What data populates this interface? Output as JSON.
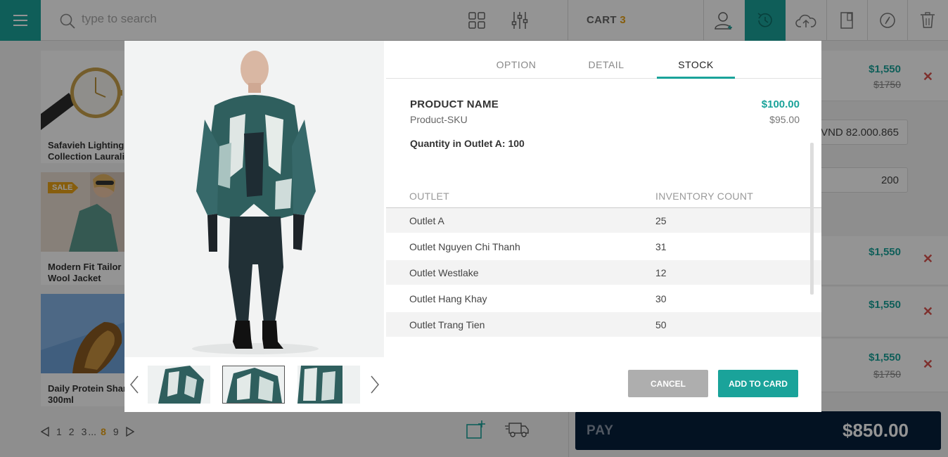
{
  "search": {
    "placeholder": "type to search"
  },
  "cart": {
    "label": "CART",
    "count": "3"
  },
  "products": [
    {
      "name_line1": "Safavieh Lighting",
      "name_line2": "Collection Laurali"
    },
    {
      "name_line1": "Modern Fit Tailor",
      "name_line2": "Wool Jacket",
      "badge": "SALE"
    },
    {
      "name_line1": "Daily Protein Shar",
      "name_line2": "300ml"
    }
  ],
  "pagination": {
    "pages": [
      "1",
      "2",
      "3",
      "...",
      "8",
      "9"
    ],
    "current": "8"
  },
  "cart_panel": {
    "items": [
      {
        "price": "$1,550",
        "old_price": "$1750"
      },
      {
        "price": "$1,550"
      },
      {
        "price": "$1,550"
      },
      {
        "price": "$1,550",
        "old_price": "$1750"
      }
    ],
    "currency_value": "VND 82.000.865",
    "quantity_value": "200",
    "pay_label": "PAY",
    "pay_amount": "$850.00"
  },
  "modal": {
    "tabs": [
      {
        "label": "OPTION"
      },
      {
        "label": "DETAIL"
      },
      {
        "label": "STOCK"
      }
    ],
    "active_tab": "STOCK",
    "product_name": "PRODUCT NAME",
    "sku": "Product-SKU",
    "price": "$100.00",
    "secondary_price": "$95.00",
    "quantity_note": "Quantity in Outlet A: 100",
    "table": {
      "headers": [
        "OUTLET",
        "INVENTORY COUNT"
      ],
      "rows": [
        [
          "Outlet A",
          "25"
        ],
        [
          "Outlet Nguyen Chi Thanh",
          "31"
        ],
        [
          "Outlet Westlake",
          "12"
        ],
        [
          "Outlet Hang Khay",
          "30"
        ],
        [
          "Outlet Trang Tien",
          "50"
        ]
      ]
    },
    "cancel_label": "CANCEL",
    "add_label": "ADD TO CARD"
  },
  "colors": {
    "accent": "#1aa39a",
    "highlight": "#e8a317",
    "danger": "#d9534f",
    "pay_bg": "#06203b"
  },
  "icons": [
    "menu-icon",
    "search-icon",
    "grid-icon",
    "filter-icon",
    "add-user-icon",
    "history-icon",
    "cloud-upload-icon",
    "door-icon",
    "compass-icon",
    "trash-icon",
    "new-order-icon",
    "delivery-truck-icon",
    "chevron-left-icon",
    "chevron-right-icon"
  ]
}
